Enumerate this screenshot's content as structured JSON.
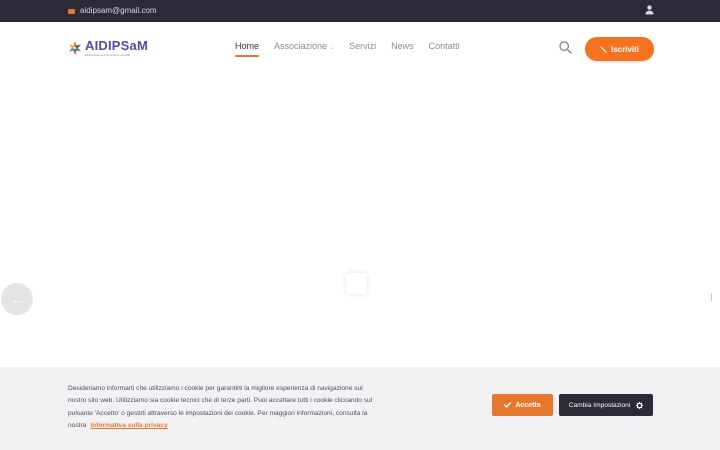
{
  "topbar": {
    "email": "aidipsam@gmail.com",
    "email_icon": "envelope-icon",
    "user_icon": "user-icon"
  },
  "header": {
    "logo_name": "AIDIPSaM",
    "logo_tagline": "Associazione Promozione Sociale",
    "nav": [
      {
        "label": "Home",
        "active": true
      },
      {
        "label": "Associazione",
        "has_dropdown": true
      },
      {
        "label": "Servizi"
      },
      {
        "label": "News"
      },
      {
        "label": "Contatti"
      }
    ],
    "search_icon": "search-icon",
    "cta_label": "Iscriviti",
    "cta_icon": "pencil-icon"
  },
  "slider": {
    "prev_arrow": "←"
  },
  "cookie": {
    "message": "Desideriamo informarti che utilizziamo i cookie per garantirti la migliore esperienza di navigazione sul nostro sito web. Utilizziamo sia cookie tecnici che di terze parti. Puoi accettare tutti i cookie cliccando sul pulsante 'Accetto' o gestirli attraverso le impostazioni dei cookie. Per maggiori informazioni, consulta la nostra",
    "privacy_link": "Informativa sulla privacy",
    "accept_label": "Accetta",
    "settings_label": "Cambia Impostazioni"
  },
  "colors": {
    "accent": "#f47321",
    "dark": "#2c2a36",
    "brand": "#4a4fa8"
  }
}
